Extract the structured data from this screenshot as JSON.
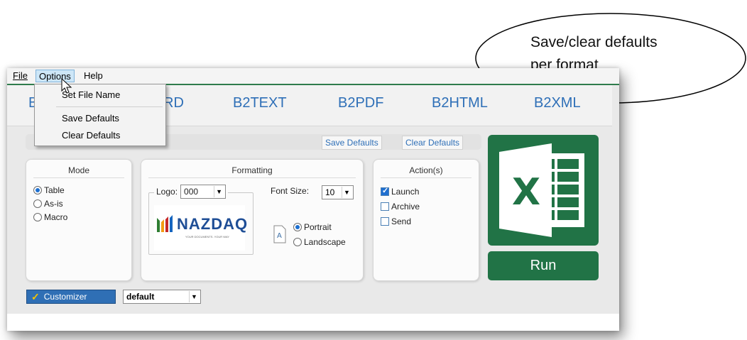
{
  "menubar": {
    "items": [
      "File",
      "Options",
      "Help"
    ]
  },
  "options_menu": {
    "items": [
      "Set File Name",
      "Save Defaults",
      "Clear Defaults"
    ]
  },
  "tabs": [
    "B2WORD",
    "B2TEXT",
    "B2PDF",
    "B2HTML",
    "B2XML"
  ],
  "toolbar": {
    "save_defaults": "Save Defaults",
    "clear_defaults": "Clear Defaults"
  },
  "mode_panel": {
    "title": "Mode",
    "options": [
      "Table",
      "As-is",
      "Macro"
    ],
    "selected": "Table"
  },
  "formatting_panel": {
    "title": "Formatting",
    "logo_label": "Logo:",
    "logo_value": "000",
    "font_size_label": "Font Size:",
    "font_size_value": "10",
    "logo_brand": "NAZDAQ",
    "logo_tagline": "YOUR DOCUMENTS. YOUR WAY",
    "orientation_options": [
      "Portrait",
      "Landscape"
    ],
    "orientation_selected": "Portrait"
  },
  "actions_panel": {
    "title": "Action(s)",
    "items": [
      {
        "label": "Launch",
        "checked": true
      },
      {
        "label": "Archive",
        "checked": false
      },
      {
        "label": "Send",
        "checked": false
      }
    ]
  },
  "excel_icon": {
    "letter": "X",
    "color": "#217346"
  },
  "run_button": {
    "label": "Run"
  },
  "customizer": {
    "label": "Customizer",
    "profile_value": "default"
  },
  "callout": {
    "line1": "Save/clear defaults",
    "line2": "per format"
  },
  "colors": {
    "accent_blue": "#2e6fb7",
    "excel_green": "#217346"
  }
}
